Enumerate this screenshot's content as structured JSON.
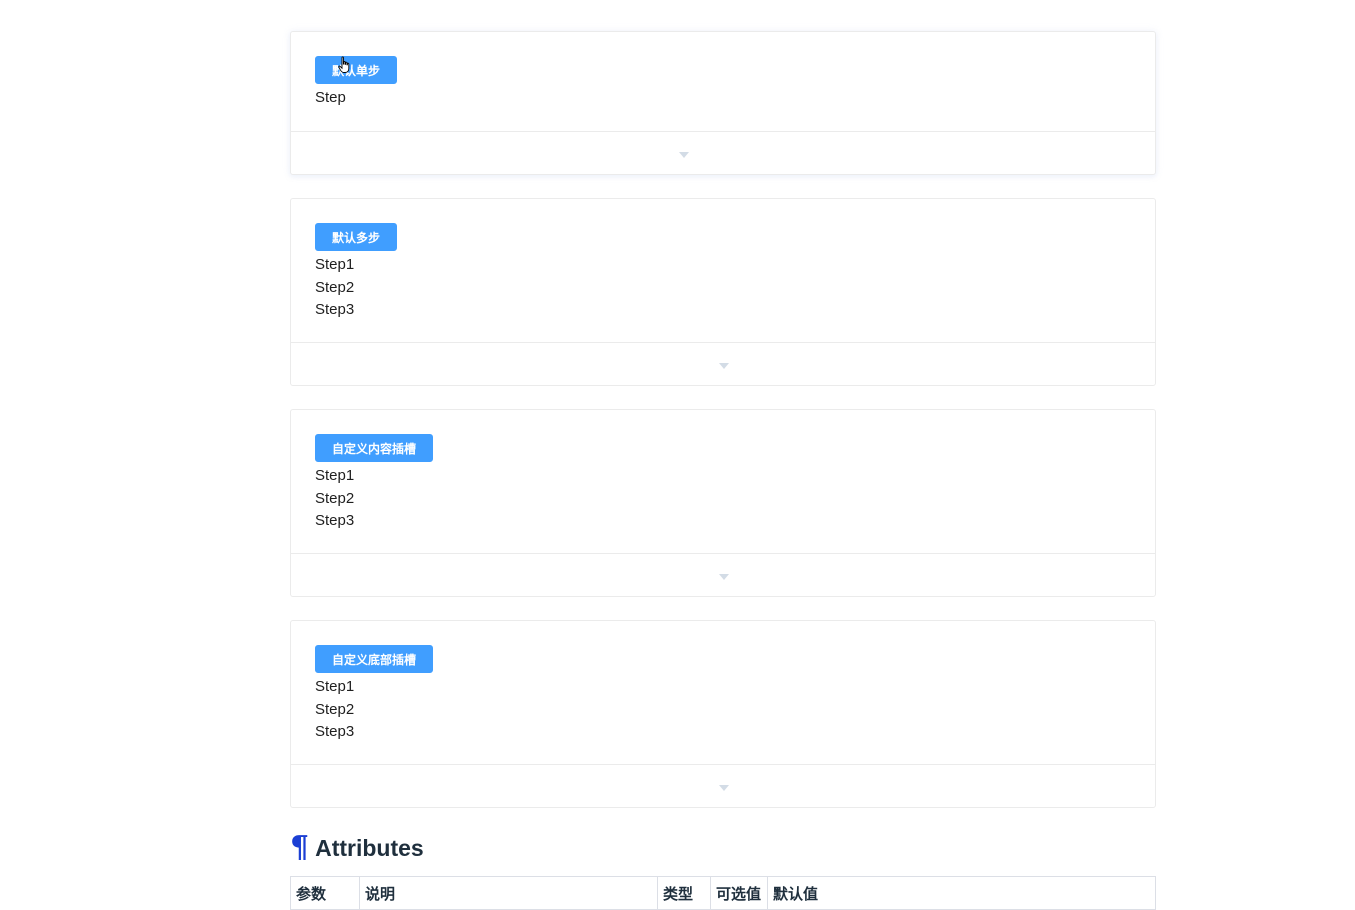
{
  "demos": [
    {
      "button_label": "默认单步",
      "steps": [
        "Step"
      ]
    },
    {
      "button_label": "默认多步",
      "steps": [
        "Step1",
        "Step2",
        "Step3"
      ]
    },
    {
      "button_label": "自定义内容插槽",
      "steps": [
        "Step1",
        "Step2",
        "Step3"
      ]
    },
    {
      "button_label": "自定义底部插槽",
      "steps": [
        "Step1",
        "Step2",
        "Step3"
      ]
    }
  ],
  "attributes": {
    "heading_icon": "¶",
    "heading": "Attributes",
    "columns": [
      "参数",
      "说明",
      "类型",
      "可选值",
      "默认值"
    ]
  },
  "colors": {
    "primary": "#409eff",
    "anchor": "#1b3fd4"
  },
  "icons": {
    "expand": "caret-down-icon",
    "cursor": "hand-pointer-icon"
  }
}
